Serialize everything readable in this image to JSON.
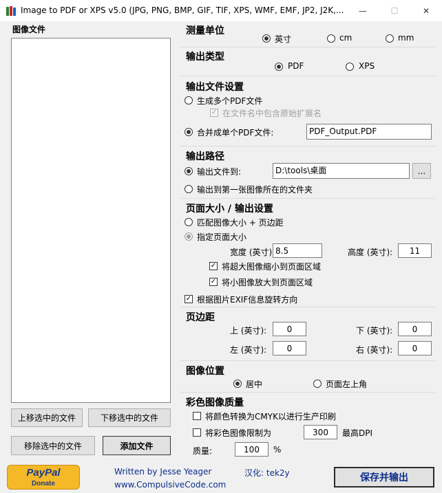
{
  "window": {
    "title": "Image to PDF or XPS  v5.0  (JPG, PNG, BMP, GIF, TIF, XPS, WMF, EMF, JP2, J2K,...",
    "minimize": "—",
    "maximize": "☐",
    "close": "✕"
  },
  "files": {
    "heading": "图像文件",
    "move_up": "上移选中的文件",
    "move_down": "下移选中的文件",
    "remove": "移除选中的文件",
    "add": "添加文件"
  },
  "units": {
    "heading": "测量单位",
    "options": [
      "英寸",
      "cm",
      "mm"
    ],
    "selected": "英寸"
  },
  "output_type": {
    "heading": "输出类型",
    "options": [
      "PDF",
      "XPS"
    ],
    "selected": "PDF"
  },
  "output_file": {
    "heading": "输出文件设置",
    "multi": "生成多个PDF文件",
    "include_ext": "在文件名中包含原始扩展名",
    "single": "合并成单个PDF文件:",
    "filename": "PDF_Output.PDF"
  },
  "output_path": {
    "heading": "输出路径",
    "to_folder": "输出文件到:",
    "folder": "D:\\tools\\桌面",
    "browse": "...",
    "first_image_folder": "输出到第一张图像所在的文件夹"
  },
  "page_size": {
    "heading": "页面大小 / 输出设置",
    "match": "匹配图像大小 + 页边距",
    "specify": "指定页面大小",
    "width_label": "宽度 (英寸):",
    "width": "8.5",
    "height_label": "高度 (英寸):",
    "height": "11",
    "shrink": "将超大图像缩小到页面区域",
    "enlarge": "将小图像放大到页面区域",
    "exif": "根据图片EXIF信息旋转方向",
    "check_mark": "✓"
  },
  "margins": {
    "heading": "页边距",
    "top_label": "上 (英寸):",
    "top": "0",
    "bottom_label": "下 (英寸):",
    "bottom": "0",
    "left_label": "左 (英寸):",
    "left": "0",
    "right_label": "右 (英寸):",
    "right": "0"
  },
  "image_position": {
    "heading": "图像位置",
    "center": "居中",
    "top_left": "页面左上角",
    "selected": "居中"
  },
  "color_quality": {
    "heading": "彩色图像质量",
    "cmyk": "将颜色转换为CMYK以进行生产印刷",
    "limit": "将彩色图像限制为",
    "dpi": "300",
    "dpi_label": "最高DPI",
    "quality_label": "质量:",
    "quality": "100",
    "percent": "%"
  },
  "footer": {
    "paypal_pay": "PayPal",
    "paypal_donate": "Donate",
    "written_by": "Written by Jesse Yeager",
    "website": "www.CompulsiveCode.com",
    "localized": "汉化: tek2y",
    "save": "保存并输出"
  },
  "colors": {
    "accent_blue": "#0b2e8a",
    "paypal_yellow": "#f5b928"
  }
}
